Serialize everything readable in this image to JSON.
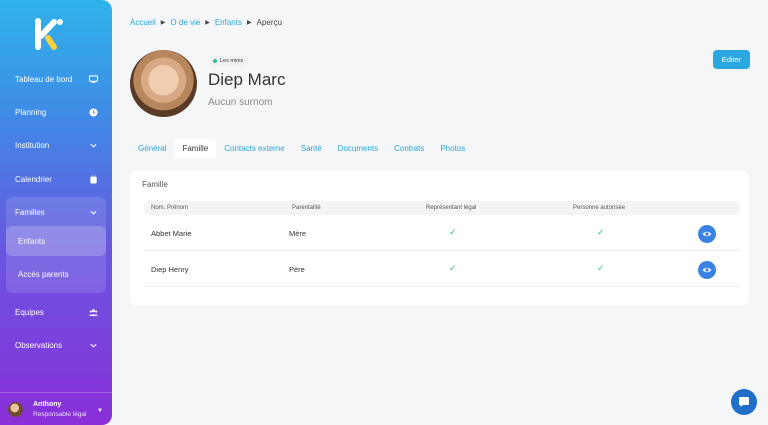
{
  "sidebar": {
    "items": [
      {
        "label": "Tableau de bord",
        "icon": "monitor-icon"
      },
      {
        "label": "Planning",
        "icon": "clock-icon"
      },
      {
        "label": "Institution",
        "icon": "chevron-down-icon"
      },
      {
        "label": "Calendrier",
        "icon": "calendar-icon"
      },
      {
        "label": "Familles",
        "icon": "chevron-down-icon"
      },
      {
        "label": "Equipes",
        "icon": "users-icon"
      },
      {
        "label": "Observations",
        "icon": "chevron-down-icon"
      }
    ],
    "subitems": [
      {
        "label": "Enfants"
      },
      {
        "label": "Accès parents"
      }
    ],
    "user": {
      "name": "Anthony",
      "role": "Responsable légal"
    }
  },
  "breadcrumb": [
    "Accueil",
    "O de vie",
    "Enfants",
    "Aperçu"
  ],
  "profile": {
    "group": "Les minis",
    "name": "Diep Marc",
    "nickname": "Aucun surnom",
    "edit_label": "Editer"
  },
  "tabs": [
    "Général",
    "Famille",
    "Contacts externe",
    "Santé",
    "Documents",
    "Contrats",
    "Photos"
  ],
  "family": {
    "title": "Famille",
    "headers": [
      "Nom, Prénom",
      "Parentalité",
      "Représentant légal",
      "Personne autorisée"
    ],
    "rows": [
      {
        "name": "Abbet Marie",
        "relation": "Mère",
        "legal": "✓",
        "authorized": "✓"
      },
      {
        "name": "Diep Henry",
        "relation": "Père",
        "legal": "✓",
        "authorized": "✓"
      }
    ]
  },
  "colors": {
    "accent": "#2aa6e0",
    "success": "#2bc48a",
    "view_button": "#3b82e6"
  }
}
